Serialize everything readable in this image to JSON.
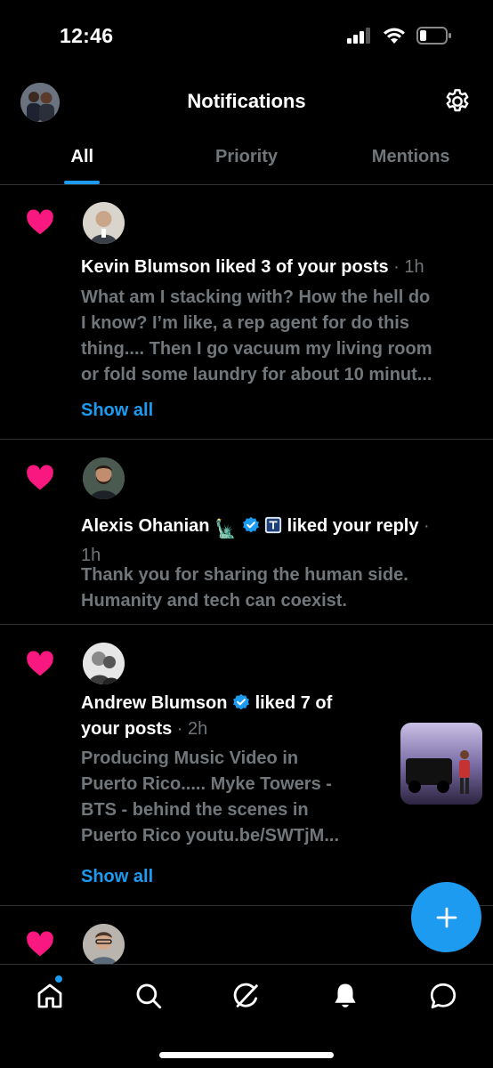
{
  "status_bar": {
    "time": "12:46"
  },
  "header": {
    "title": "Notifications"
  },
  "tabs": [
    {
      "label": "All",
      "active": true
    },
    {
      "label": "Priority",
      "active": false
    },
    {
      "label": "Mentions",
      "active": false
    }
  ],
  "notifications": [
    {
      "name": "Kevin Blumson",
      "action": " liked 3 of your posts",
      "time": "1h",
      "preview_lines": [
        "What am I stacking with? How the hell do",
        "I know? I’m like, a rep agent for do this",
        "thing.... Then I go vacuum my living room",
        "or fold some laundry for about 10 minut..."
      ],
      "show_all": "Show all"
    },
    {
      "name": "Alexis Ohanian",
      "emoji": "🗽",
      "action": " liked your reply",
      "time": "1h",
      "preview_lines": [
        "Thank you for sharing the human side.",
        "Humanity and tech can coexist."
      ]
    },
    {
      "name": "Andrew Blumson",
      "action_line1": " liked 7 of",
      "action_line2": "your posts",
      "time": "2h",
      "preview_lines": [
        "Producing Music Video in",
        "Puerto Rico..... Myke Towers -",
        "BTS - behind the scenes in",
        "Puerto Rico youtu.be/SWTjM..."
      ],
      "show_all": "Show all"
    }
  ],
  "colors": {
    "accent": "#1d9bf0",
    "heart": "#f91880",
    "dim": "#71767b",
    "divider": "#2f3336"
  },
  "icons": [
    "settings-icon",
    "heart-icon",
    "verified-badge-icon",
    "compose-plus-icon",
    "home-icon",
    "search-icon",
    "grok-icon",
    "bell-icon",
    "message-icon"
  ]
}
